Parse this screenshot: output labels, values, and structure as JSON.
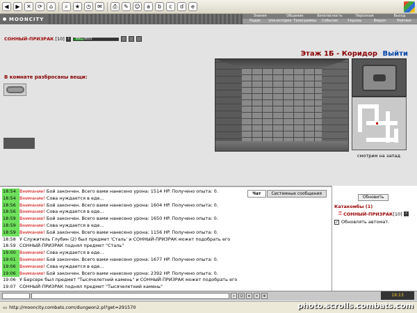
{
  "browser": {
    "toolbar_icons": [
      "back-arrow-icon",
      "forward-arrow-icon",
      "stop-icon",
      "refresh-icon",
      "home-icon",
      "search-icon",
      "favorites-icon",
      "history-icon",
      "mail-icon",
      "print-icon",
      "edit-icon",
      "messenger-icon",
      "toolbar-a-icon",
      "toolbar-b-icon",
      "toolbar-c-icon",
      "toolbar-d-icon",
      "toolbar-e-icon"
    ],
    "status_url": "http://mooncity.combats.com/dungeon2.pl?get=291570",
    "status_zone": "Интернет"
  },
  "header": {
    "logo": "MOONCITY",
    "nav_top": [
      "Знания",
      "Общение",
      "Безопасность",
      "Персонаж",
      "Выход"
    ],
    "nav_bottom": [
      "Радио",
      "sms-история",
      "Телеграммы",
      "События",
      "Скролы",
      "Форум",
      "Рейтинг"
    ]
  },
  "player": {
    "name": "СОННЫЙ-ПРИЗРАК",
    "level": "[10]",
    "hp": "891/3855",
    "hp_fraction": 0.23
  },
  "location": {
    "title": "Этаж 1Б - Коридор",
    "exit": "Выйти",
    "facing": "смотрим на запад"
  },
  "room": {
    "items_title": "В комнате разбросаны вещи:"
  },
  "chat": {
    "tabs": [
      "Чат",
      "Системные сообщения"
    ],
    "lines": [
      {
        "time": "18:54",
        "warn": "Внимание!",
        "text": "Бой закончен. Всего вами нанесено урона: 1514 HP. Получено опыта: 0.",
        "hi": true
      },
      {
        "time": "18:54",
        "warn": "Внимание!",
        "text": "Сова нуждается в еде...",
        "hi": true
      },
      {
        "time": "18:56",
        "warn": "Внимание!",
        "text": "Бой закончен. Всего вами нанесено урона: 1604 HP. Получено опыта: 0.",
        "hi": true
      },
      {
        "time": "18:56",
        "warn": "Внимание!",
        "text": "Сова нуждается в еде...",
        "hi": true
      },
      {
        "time": "18:59",
        "warn": "Внимание!",
        "text": "Бой закончен. Всего вами нанесено урона: 1650 HP. Получено опыта: 0.",
        "hi": true
      },
      {
        "time": "18:59",
        "warn": "Внимание!",
        "text": "Сова нуждается в еде...",
        "hi": true
      },
      {
        "time": "18:59",
        "warn": "Внимание!",
        "text": "Бой закончен. Всего вами нанесено урона: 1156 HP. Получено опыта: 0.",
        "hi": true
      },
      {
        "time": "18:58",
        "warn": "",
        "text": "У Служитель Глубин (2) был предмет 'Сталь' и СОННЫЙ-ПРИЗРАК может подобрать его",
        "hi": false
      },
      {
        "time": "18:59",
        "warn": "",
        "text": "СОННЫЙ-ПРИЗРАК поднял предмет \"Сталь\"",
        "hi": false
      },
      {
        "time": "19:00",
        "warn": "Внимание!",
        "text": "Сова нуждается в еде...",
        "hi": true
      },
      {
        "time": "19:01",
        "warn": "Внимание!",
        "text": "Бой закончен. Всего вами нанесено урона: 1677 HP. Получено опыта: 0.",
        "hi": true
      },
      {
        "time": "19:06",
        "warn": "Внимание!",
        "text": "Сова нуждается в еде...",
        "hi": true
      },
      {
        "time": "19:06",
        "warn": "Внимание!",
        "text": "Бой закончен. Всего вами нанесено урона: 2392 HP. Получено опыта: 0.",
        "hi": true
      },
      {
        "time": "19:06",
        "warn": "",
        "text": "У Берсерк был предмет \"Тысячелетний камень\" и СОННЫЙ-ПРИЗРАК может подобрать его",
        "hi": false
      },
      {
        "time": "19:07",
        "warn": "",
        "text": "СОННЫЙ-ПРИЗРАК поднял предмет \"Тысячелетний камень\"",
        "hi": false
      },
      {
        "time": "19:12",
        "warn": "Внимание!",
        "text": "Сова нуждается в еде...",
        "hi": true
      },
      {
        "time": "19:12",
        "warn": "Внимание!",
        "text": "Бой закончен. Всего вами нанесено урона: 1200 HP. Получено опыта: 0.",
        "hi": true
      },
      {
        "time": "19:11",
        "warn": "",
        "text": "У Надзиратель Глубин (2) был предмет 'Пояс Древнего Лича' и кто угодно может подобрать его",
        "hi": false
      }
    ]
  },
  "sidebar": {
    "refresh": "Обновить",
    "category": "Катакомбы (1)",
    "user": "СОННЫЙ-ПРИЗРАК",
    "user_level": "[10]",
    "auto_refresh": "Обновлять автомат."
  },
  "clock": "19:13",
  "watermark": "photo.scrolls.combats.com"
}
